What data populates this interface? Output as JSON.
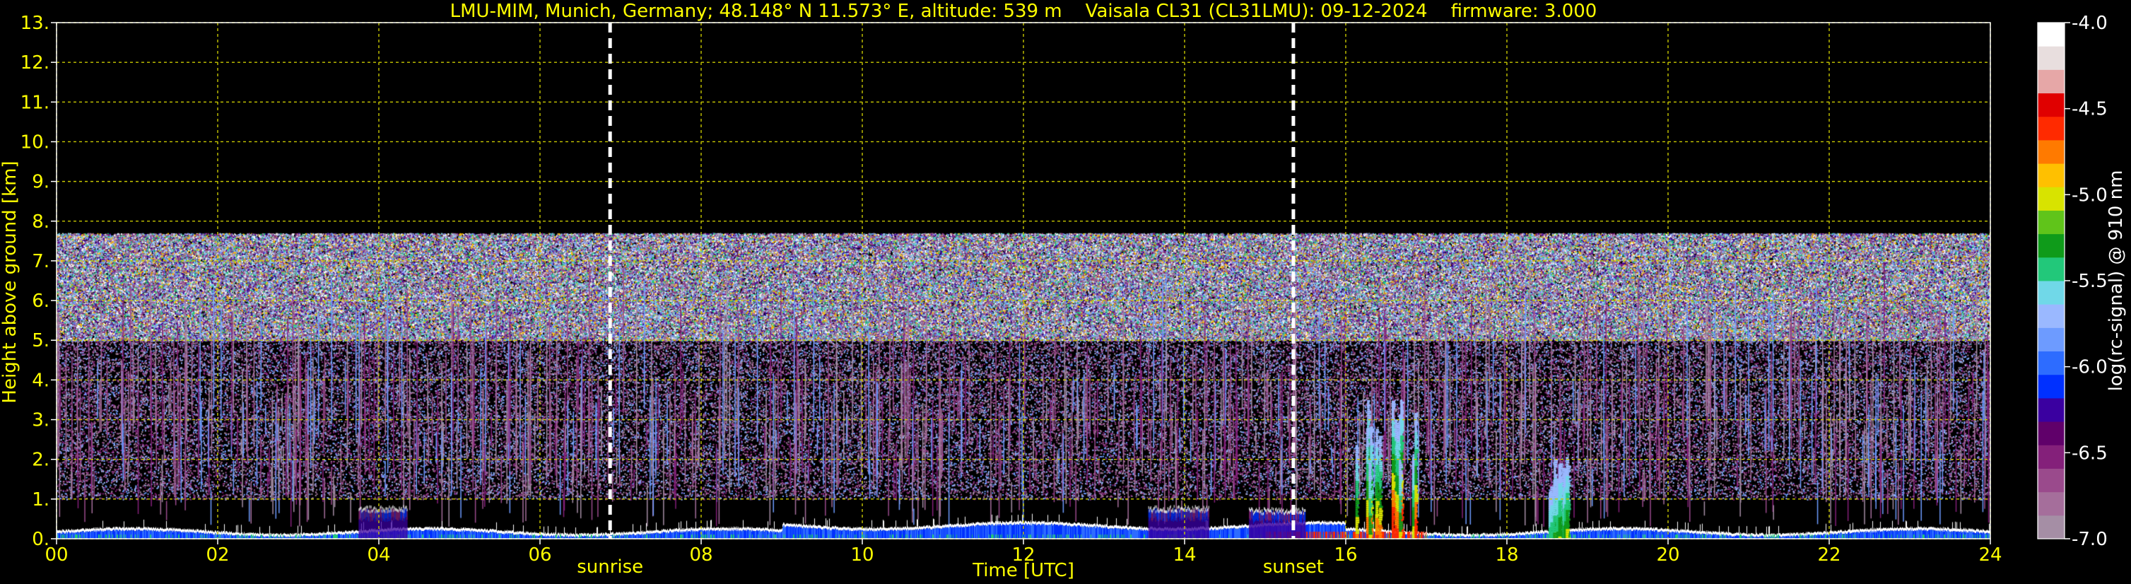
{
  "chart_data": {
    "type": "heatmap",
    "title": "LMU-MIM, Munich, Germany; 48.148° N 11.573° E, altitude: 539 m    Vaisala CL31 (CL31LMU): 09-12-2024    firmware: 3.000",
    "xlabel": "Time [UTC]",
    "ylabel": "Height above ground [km]",
    "xlim": [
      0,
      24
    ],
    "ylim": [
      0,
      13
    ],
    "x_ticks": [
      0,
      2,
      4,
      6,
      8,
      10,
      12,
      14,
      16,
      18,
      20,
      22,
      24
    ],
    "x_tick_labels": [
      "00",
      "02",
      "04",
      "06",
      "08",
      "10",
      "12",
      "14",
      "16",
      "18",
      "20",
      "22",
      "24"
    ],
    "y_ticks": [
      0,
      1,
      2,
      3,
      4,
      5,
      6,
      7,
      8,
      9,
      10,
      11,
      12,
      13
    ],
    "y_tick_labels": [
      "0.",
      "1.",
      "2.",
      "3.",
      "4.",
      "5.",
      "6.",
      "7.",
      "8.",
      "9.",
      "10.",
      "11.",
      "12.",
      "13."
    ],
    "grid": true,
    "grid_color": "#c8c800",
    "signal_top_km": 7.7,
    "events": [
      {
        "label": "sunrise",
        "time": 6.87
      },
      {
        "label": "sunset",
        "time": 15.35
      }
    ],
    "colorbar": {
      "label": "log(rc-signal) @ 910 nm",
      "ticks": [
        -4.0,
        -4.5,
        -5.0,
        -5.5,
        -6.0,
        -6.5,
        -7.0
      ],
      "tick_labels": [
        "-4.0",
        "-4.5",
        "-5.0",
        "-5.5",
        "-6.0",
        "-6.5",
        "-7.0"
      ],
      "range": [
        -7.0,
        -4.0
      ],
      "colors": [
        "#a58ea5",
        "#a56e9b",
        "#9a4a8c",
        "#84207a",
        "#60006a",
        "#3a00a0",
        "#0030ff",
        "#2d6cff",
        "#6d9bff",
        "#9ab8ff",
        "#70d8e8",
        "#22c87a",
        "#0f9b1a",
        "#60c41a",
        "#d8e300",
        "#ffc000",
        "#ff7a00",
        "#ff2a00",
        "#e00000",
        "#e6a7a7",
        "#e8dede",
        "#ffffff"
      ]
    },
    "features": [
      {
        "type": "cloud",
        "time_start": 3.75,
        "time_end": 4.35,
        "height_km": 0.85
      },
      {
        "type": "cloud",
        "time_start": 13.55,
        "time_end": 14.3,
        "height_km": 0.85
      },
      {
        "type": "cloud",
        "time_start": 14.8,
        "time_end": 15.5,
        "height_km": 0.8
      },
      {
        "type": "convective",
        "time_start": 16.0,
        "time_end": 17.0,
        "height_km": 3.6
      },
      {
        "type": "convective",
        "time_start": 18.5,
        "time_end": 18.75,
        "height_km": 2.1
      }
    ]
  }
}
